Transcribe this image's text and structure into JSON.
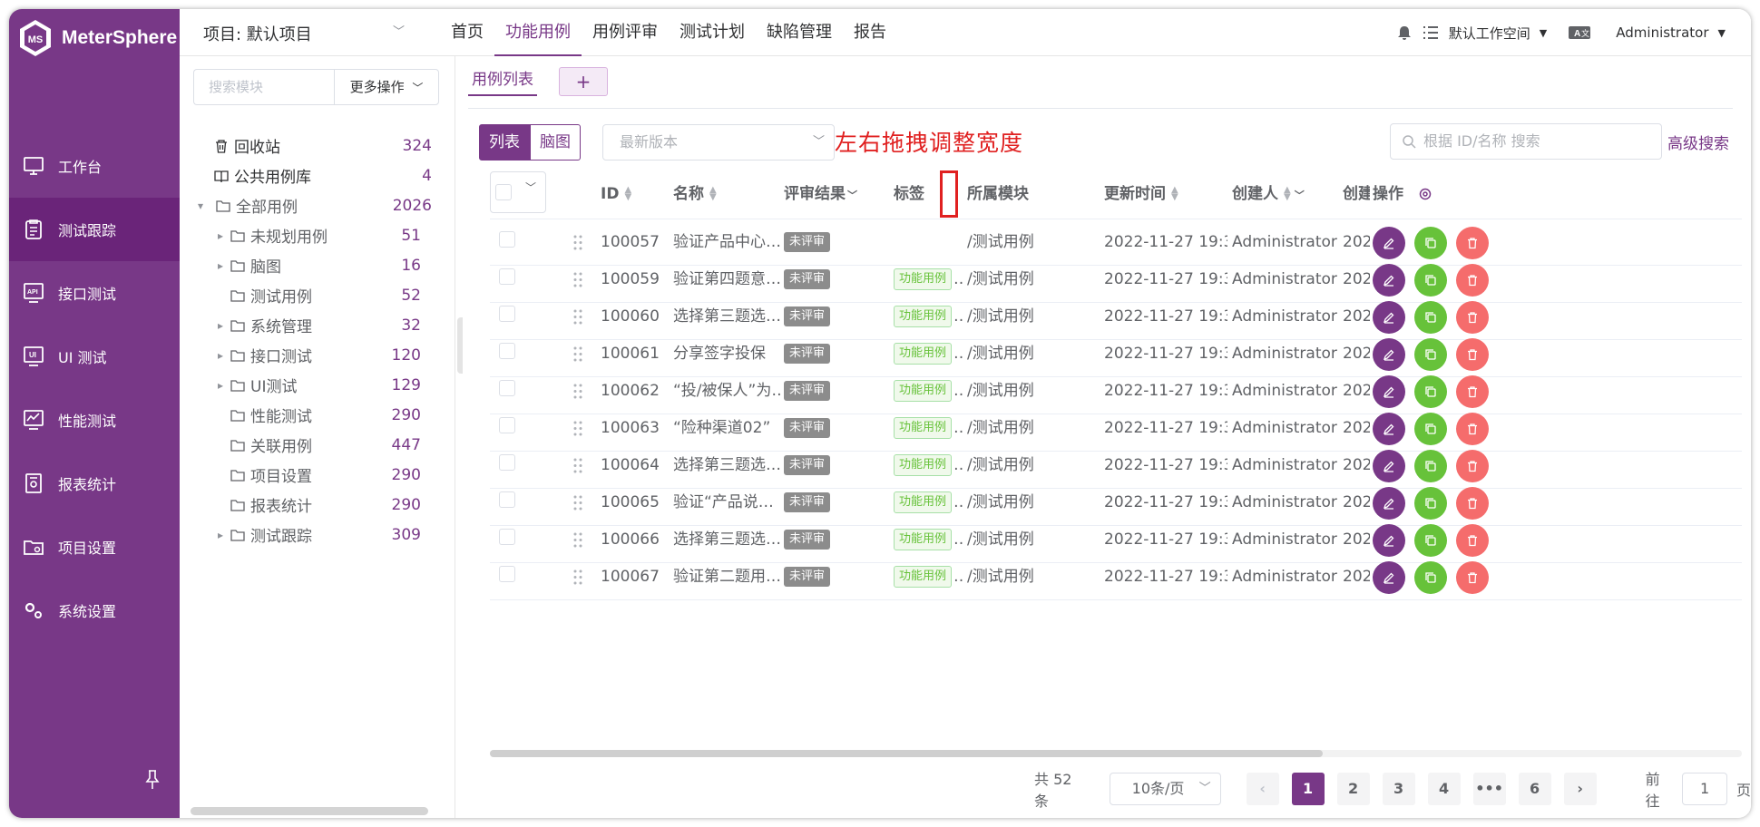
{
  "app": {
    "name": "MeterSphere"
  },
  "sidebar": {
    "items": [
      {
        "label": "工作台",
        "icon": "monitor-icon",
        "active": false
      },
      {
        "label": "测试跟踪",
        "icon": "clipboard-icon",
        "active": true
      },
      {
        "label": "接口测试",
        "icon": "api-icon",
        "active": false
      },
      {
        "label": "UI 测试",
        "icon": "ui-icon",
        "active": false
      },
      {
        "label": "性能测试",
        "icon": "performance-icon",
        "active": false
      },
      {
        "label": "报表统计",
        "icon": "report-icon",
        "active": false
      },
      {
        "label": "项目设置",
        "icon": "folder-settings-icon",
        "active": false
      },
      {
        "label": "系统设置",
        "icon": "gears-icon",
        "active": false
      }
    ]
  },
  "header": {
    "project": "项目: 默认项目",
    "nav": [
      "首页",
      "功能用例",
      "用例评审",
      "测试计划",
      "缺陷管理",
      "报告"
    ],
    "active_nav": "功能用例",
    "workspace": "默认工作空间",
    "user": "Administrator"
  },
  "modules": {
    "search_placeholder": "搜索模块",
    "more_ops": "更多操作",
    "tree": [
      {
        "label": "回收站",
        "count": "324",
        "level": 0,
        "icon": "trash-icon",
        "arrow": false,
        "bold": true
      },
      {
        "label": "公共用例库",
        "count": "4",
        "level": 0,
        "icon": "book-icon",
        "arrow": false,
        "bold": true
      },
      {
        "label": "全部用例",
        "count": "2026",
        "level": 0,
        "icon": "folder-icon",
        "arrow": "down",
        "bold": false
      },
      {
        "label": "未规划用例",
        "count": "51",
        "level": 1,
        "icon": "folder-icon",
        "arrow": "right",
        "bold": false
      },
      {
        "label": "脑图",
        "count": "16",
        "level": 1,
        "icon": "folder-icon",
        "arrow": "right",
        "bold": false
      },
      {
        "label": "测试用例",
        "count": "52",
        "level": 1,
        "icon": "folder-icon",
        "arrow": false,
        "bold": false
      },
      {
        "label": "系统管理",
        "count": "32",
        "level": 1,
        "icon": "folder-icon",
        "arrow": "right",
        "bold": false
      },
      {
        "label": "接口测试",
        "count": "120",
        "level": 1,
        "icon": "folder-icon",
        "arrow": "right",
        "bold": false
      },
      {
        "label": "UI测试",
        "count": "129",
        "level": 1,
        "icon": "folder-icon",
        "arrow": "right",
        "bold": false
      },
      {
        "label": "性能测试",
        "count": "290",
        "level": 1,
        "icon": "folder-icon",
        "arrow": false,
        "bold": false
      },
      {
        "label": "关联用例",
        "count": "447",
        "level": 1,
        "icon": "folder-icon",
        "arrow": false,
        "bold": false
      },
      {
        "label": "项目设置",
        "count": "290",
        "level": 1,
        "icon": "folder-icon",
        "arrow": false,
        "bold": false
      },
      {
        "label": "报表统计",
        "count": "290",
        "level": 1,
        "icon": "folder-icon",
        "arrow": false,
        "bold": false
      },
      {
        "label": "测试跟踪",
        "count": "309",
        "level": 1,
        "icon": "folder-icon",
        "arrow": "right",
        "bold": false
      }
    ]
  },
  "main": {
    "tab_label": "用例列表",
    "tab_add": "+",
    "view_list": "列表",
    "view_mind": "脑图",
    "version_placeholder": "最新版本",
    "annotation": "左右拖拽调整宽度",
    "search_placeholder": "根据 ID/名称 搜索",
    "advanced_search": "高级搜索",
    "columns": {
      "id": "ID",
      "name": "名称",
      "review": "评审结果",
      "tags": "标签",
      "module": "所属模块",
      "updated": "更新时间",
      "creator": "创建人",
      "created": "创建",
      "ops": "操作"
    },
    "rows": [
      {
        "id": "100057",
        "name": "验证产品中心…",
        "review": "未评审",
        "tag": "",
        "module": "/测试用例",
        "updated": "2022-11-27 19:3…",
        "creator": "Administrator",
        "created": "202"
      },
      {
        "id": "100059",
        "name": "验证第四题意…",
        "review": "未评审",
        "tag": "功能用例",
        "module": "/测试用例",
        "updated": "2022-11-27 19:3…",
        "creator": "Administrator",
        "created": "202"
      },
      {
        "id": "100060",
        "name": "选择第三题选…",
        "review": "未评审",
        "tag": "功能用例",
        "module": "/测试用例",
        "updated": "2022-11-27 19:3…",
        "creator": "Administrator",
        "created": "202"
      },
      {
        "id": "100061",
        "name": "分享签字投保",
        "review": "未评审",
        "tag": "功能用例",
        "module": "/测试用例",
        "updated": "2022-11-27 19:3…",
        "creator": "Administrator",
        "created": "202"
      },
      {
        "id": "100062",
        "name": "“投/被保人”为…",
        "review": "未评审",
        "tag": "功能用例",
        "module": "/测试用例",
        "updated": "2022-11-27 19:3…",
        "creator": "Administrator",
        "created": "202"
      },
      {
        "id": "100063",
        "name": "“险种渠道02”",
        "review": "未评审",
        "tag": "功能用例",
        "module": "/测试用例",
        "updated": "2022-11-27 19:3…",
        "creator": "Administrator",
        "created": "202"
      },
      {
        "id": "100064",
        "name": "选择第三题选…",
        "review": "未评审",
        "tag": "功能用例",
        "module": "/测试用例",
        "updated": "2022-11-27 19:3…",
        "creator": "Administrator",
        "created": "202"
      },
      {
        "id": "100065",
        "name": "验证“产品说…",
        "review": "未评审",
        "tag": "功能用例",
        "module": "/测试用例",
        "updated": "2022-11-27 19:3…",
        "creator": "Administrator",
        "created": "202"
      },
      {
        "id": "100066",
        "name": "选择第三题选…",
        "review": "未评审",
        "tag": "功能用例",
        "module": "/测试用例",
        "updated": "2022-11-27 19:3…",
        "creator": "Administrator",
        "created": "202"
      },
      {
        "id": "100067",
        "name": "验证第二题用…",
        "review": "未评审",
        "tag": "功能用例",
        "module": "/测试用例",
        "updated": "2022-11-27 19:3…",
        "creator": "Administrator",
        "created": "202"
      }
    ]
  },
  "pagination": {
    "total": "共 52 条",
    "page_size": "10条/页",
    "pages": [
      "1",
      "2",
      "3",
      "4",
      "•••",
      "6"
    ],
    "current": "1",
    "goto_label": "前往",
    "goto_value": "1",
    "goto_suffix": "页"
  },
  "colors": {
    "primary": "#783887",
    "success": "#67c23a",
    "danger": "#f56c6c",
    "annotation": "#e02020"
  }
}
